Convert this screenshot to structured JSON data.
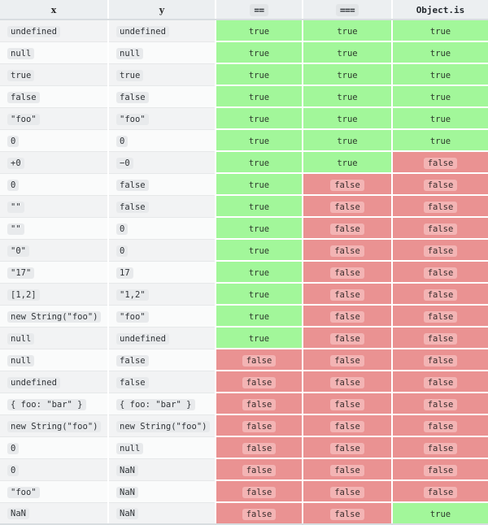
{
  "table": {
    "headers": [
      {
        "label": "x",
        "style": "var"
      },
      {
        "label": "y",
        "style": "var"
      },
      {
        "label": "==",
        "style": "code"
      },
      {
        "label": "===",
        "style": "code"
      },
      {
        "label": "Object.is",
        "style": "plain"
      }
    ],
    "rows": [
      {
        "x": "undefined",
        "y": "undefined",
        "eq": "true",
        "streq": "true",
        "objectis": "true"
      },
      {
        "x": "null",
        "y": "null",
        "eq": "true",
        "streq": "true",
        "objectis": "true"
      },
      {
        "x": "true",
        "y": "true",
        "eq": "true",
        "streq": "true",
        "objectis": "true"
      },
      {
        "x": "false",
        "y": "false",
        "eq": "true",
        "streq": "true",
        "objectis": "true"
      },
      {
        "x": "\"foo\"",
        "y": "\"foo\"",
        "eq": "true",
        "streq": "true",
        "objectis": "true"
      },
      {
        "x": "0",
        "y": "0",
        "eq": "true",
        "streq": "true",
        "objectis": "true"
      },
      {
        "x": "+0",
        "y": "−0",
        "eq": "true",
        "streq": "true",
        "objectis": "false"
      },
      {
        "x": "0",
        "y": "false",
        "eq": "true",
        "streq": "false",
        "objectis": "false"
      },
      {
        "x": "\"\"",
        "y": "false",
        "eq": "true",
        "streq": "false",
        "objectis": "false"
      },
      {
        "x": "\"\"",
        "y": "0",
        "eq": "true",
        "streq": "false",
        "objectis": "false"
      },
      {
        "x": "\"0\"",
        "y": "0",
        "eq": "true",
        "streq": "false",
        "objectis": "false"
      },
      {
        "x": "\"17\"",
        "y": "17",
        "eq": "true",
        "streq": "false",
        "objectis": "false"
      },
      {
        "x": "[1,2]",
        "y": "\"1,2\"",
        "eq": "true",
        "streq": "false",
        "objectis": "false"
      },
      {
        "x": "new String(\"foo\")",
        "y": "\"foo\"",
        "eq": "true",
        "streq": "false",
        "objectis": "false"
      },
      {
        "x": "null",
        "y": "undefined",
        "eq": "true",
        "streq": "false",
        "objectis": "false"
      },
      {
        "x": "null",
        "y": "false",
        "eq": "false",
        "streq": "false",
        "objectis": "false"
      },
      {
        "x": "undefined",
        "y": "false",
        "eq": "false",
        "streq": "false",
        "objectis": "false"
      },
      {
        "x": "{ foo: \"bar\" }",
        "y": "{ foo: \"bar\" }",
        "eq": "false",
        "streq": "false",
        "objectis": "false"
      },
      {
        "x": "new String(\"foo\")",
        "y": "new String(\"foo\")",
        "eq": "false",
        "streq": "false",
        "objectis": "false"
      },
      {
        "x": "0",
        "y": "null",
        "eq": "false",
        "streq": "false",
        "objectis": "false"
      },
      {
        "x": "0",
        "y": "NaN",
        "eq": "false",
        "streq": "false",
        "objectis": "false"
      },
      {
        "x": "\"foo\"",
        "y": "NaN",
        "eq": "false",
        "streq": "false",
        "objectis": "false"
      },
      {
        "x": "NaN",
        "y": "NaN",
        "eq": "false",
        "streq": "false",
        "objectis": "true"
      }
    ]
  },
  "colors": {
    "true_background": "#a2f79a",
    "false_background": "#ea9292",
    "header_background": "#eceff1",
    "code_chip_background": "#e8eaec",
    "row_stripe": "#f2f3f4",
    "row_alt": "#fafbfb"
  }
}
